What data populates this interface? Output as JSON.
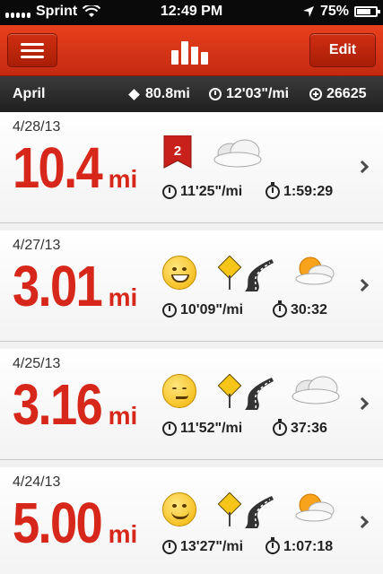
{
  "status_bar": {
    "carrier": "Sprint",
    "time": "12:49 PM",
    "battery": "75%",
    "battery_level": 0.75
  },
  "nav": {
    "menu_icon": "hamburger-menu-icon",
    "center_icon": "bar-chart-icon",
    "edit_label": "Edit"
  },
  "summary": {
    "month": "April",
    "distance": "80.8mi",
    "pace": "12'03\"/mi",
    "fuel": "26625"
  },
  "runs": [
    {
      "date": "4/28/13",
      "distance": "10.4",
      "unit": "mi",
      "badge": "2",
      "mood": "",
      "terrain": "",
      "weather": "cloudy",
      "pace": "11'25\"/mi",
      "duration": "1:59:29"
    },
    {
      "date": "4/27/13",
      "distance": "3.01",
      "unit": "mi",
      "badge": "",
      "mood": "grin",
      "terrain": "road",
      "weather": "partly-sunny",
      "pace": "10'09\"/mi",
      "duration": "30:32"
    },
    {
      "date": "4/25/13",
      "distance": "3.16",
      "unit": "mi",
      "badge": "",
      "mood": "smirk",
      "terrain": "road",
      "weather": "cloudy",
      "pace": "11'52\"/mi",
      "duration": "37:36"
    },
    {
      "date": "4/24/13",
      "distance": "5.00",
      "unit": "mi",
      "badge": "",
      "mood": "content",
      "terrain": "road",
      "weather": "partly-sunny",
      "pace": "13'27\"/mi",
      "duration": "1:07:18"
    }
  ],
  "colors": {
    "accent": "#d6271a",
    "nav_bar": "#d8361a",
    "summary_bar": "#2a2a2a"
  }
}
